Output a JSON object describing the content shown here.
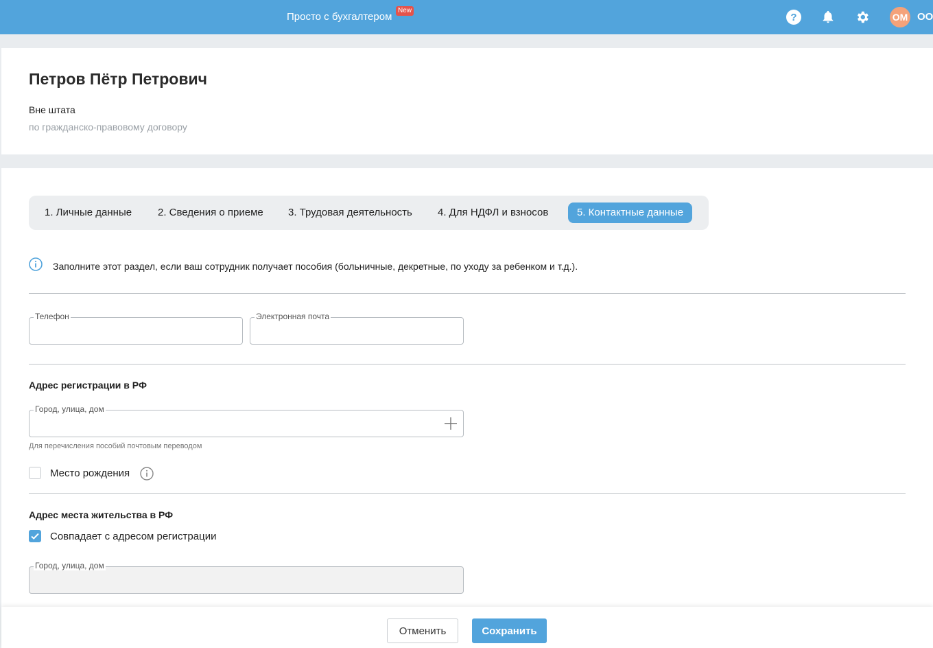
{
  "topbar": {
    "brand": "Просто с бухгалтером",
    "badge": "New",
    "avatar": "ОМ",
    "org": "ООО",
    "icons": [
      "help-icon",
      "bell-icon",
      "gear-icon"
    ]
  },
  "header": {
    "name": "Петров Пётр Петрович",
    "status": "Вне штата",
    "substatus": "по гражданско-правовому договору"
  },
  "tabs": [
    {
      "label": "1. Личные данные"
    },
    {
      "label": "2. Сведения о приеме"
    },
    {
      "label": "3. Трудовая деятельность"
    },
    {
      "label": "4. Для НДФЛ и взносов"
    },
    {
      "label": "5. Контактные данные",
      "active": true
    }
  ],
  "info": "Заполните этот раздел, если ваш сотрудник получает пособия (больничные, декретные, по уходу за ребенком и т.д.).",
  "contacts": {
    "phone_label": "Телефон",
    "phone_value": "",
    "email_label": "Электронная почта",
    "email_value": ""
  },
  "registration": {
    "title": "Адрес регистрации в РФ",
    "address_label": "Город, улица, дом",
    "address_value": "",
    "hint": "Для перечисления пособий почтовым переводом",
    "birthplace_label": "Место рождения",
    "birthplace_checked": false
  },
  "residence": {
    "title": "Адрес места жительства в РФ",
    "same_label": "Совпадает с адресом регистрации",
    "same_checked": true,
    "address_label": "Город, улица, дом",
    "address_value": ""
  },
  "footer": {
    "cancel": "Отменить",
    "save": "Сохранить"
  },
  "colors": {
    "accent": "#52a4dc",
    "badge": "#e5534b",
    "avatar": "#f4a27a"
  }
}
